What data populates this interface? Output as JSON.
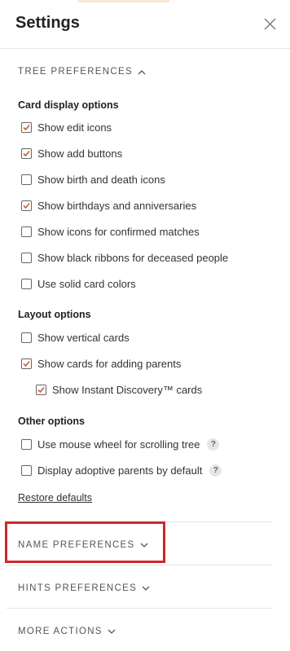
{
  "header": {
    "title": "Settings",
    "close_icon": "close-icon"
  },
  "tree_preferences": {
    "label": "TREE PREFERENCES",
    "card_display": {
      "title": "Card display options",
      "options": [
        {
          "label": "Show edit icons",
          "checked": true
        },
        {
          "label": "Show add buttons",
          "checked": true
        },
        {
          "label": "Show birth and death icons",
          "checked": false
        },
        {
          "label": "Show birthdays and anniversaries",
          "checked": true
        },
        {
          "label": "Show icons for confirmed matches",
          "checked": false
        },
        {
          "label": "Show black ribbons for deceased people",
          "checked": false
        },
        {
          "label": "Use solid card colors",
          "checked": false
        }
      ]
    },
    "layout": {
      "title": "Layout options",
      "options": [
        {
          "label": "Show vertical cards",
          "checked": false
        },
        {
          "label": "Show cards for adding parents",
          "checked": true
        },
        {
          "label": "Show Instant Discovery™ cards",
          "checked": true
        }
      ]
    },
    "other": {
      "title": "Other options",
      "options": [
        {
          "label": "Use mouse wheel for scrolling tree",
          "checked": false,
          "help": "?"
        },
        {
          "label": "Display adoptive parents by default",
          "checked": false,
          "help": "?"
        }
      ]
    },
    "restore_defaults": "Restore defaults"
  },
  "name_preferences": {
    "label": "NAME PREFERENCES"
  },
  "hints_preferences": {
    "label": "HINTS PREFERENCES"
  },
  "more_actions": {
    "label": "MORE ACTIONS"
  },
  "colors": {
    "checkbox_accent": "#c8622a",
    "highlight": "#d0262c"
  }
}
